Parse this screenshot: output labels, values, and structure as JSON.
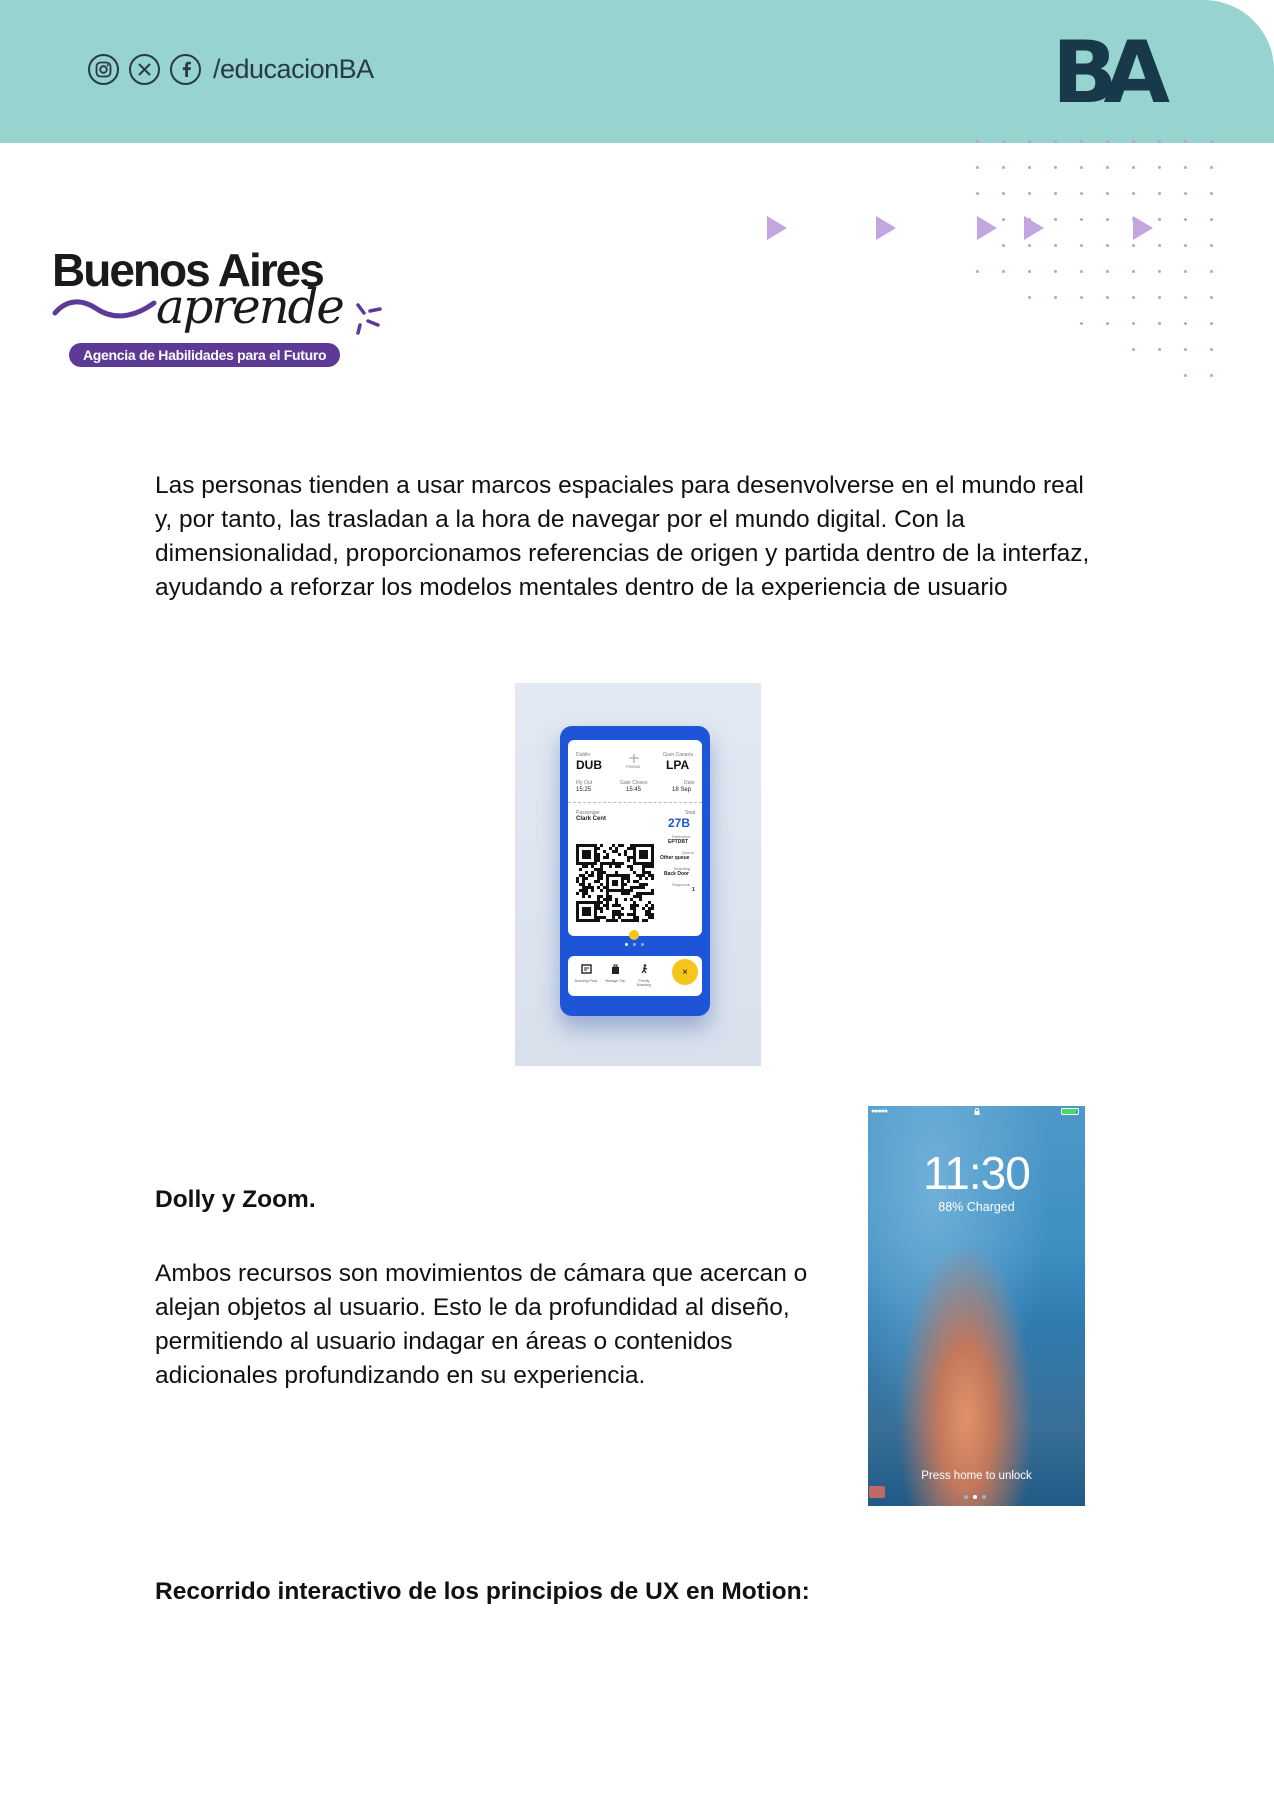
{
  "header": {
    "social_icons": [
      "instagram-icon",
      "x-icon",
      "facebook-icon"
    ],
    "handle": "/educacionBA",
    "logo_text": "BA",
    "bg_color": "#97d3cf"
  },
  "brand": {
    "line1": "Buenos Aires",
    "line2": "aprende",
    "tagline": "Agencia de Habilidades para el Futuro",
    "accent_color": "#5d3a96"
  },
  "body": {
    "paragraph1": "Las personas tienden a usar marcos espaciales para desenvolverse en el mundo real y, por tanto, las trasladan a la hora de navegar por el mundo digital. Con la dimensionalidad, proporcionamos referencias de origen y partida dentro de la interfaz, ayudando a reforzar los modelos mentales dentro de la experiencia de usuario",
    "heading1": "Dolly y Zoom.",
    "paragraph2": "Ambos recursos son movimientos de cámara que acercan o alejan objetos al usuario. Esto le da profundidad al diseño, permitiendo al usuario indagar en áreas o contenidos adicionales profundizando en su experiencia.",
    "heading2": "Recorrido interactivo de los principios de UX en Motion:"
  },
  "boarding_pass": {
    "from_city": "Dublin",
    "from": "DUB",
    "via": "FR8340",
    "to_city": "Gran Canaria",
    "to": "LPA",
    "fly_out_label": "Fly Out",
    "fly_out": "15:25",
    "gate_label": "Gate Closes",
    "gate": "15:45",
    "date_label": "Date",
    "date": "18 Sep",
    "passenger_label": "Passenger",
    "passenger": "Clark Cent",
    "seat_label": "Seat",
    "seat": "27B",
    "reference_label": "Reference",
    "reference": "EPTDBT",
    "queue_label": "Queue",
    "queue": "Other queue",
    "boarding_label": "Boarding",
    "boarding": "Back Door",
    "sequence_label": "Sequence",
    "sequence": "1",
    "nav": [
      "Boarding Pass",
      "Manage Trip",
      "Priority Boarding"
    ]
  },
  "lockscreen": {
    "time": "11:30",
    "charge": "88% Charged",
    "unlock": "Press home to unlock"
  }
}
